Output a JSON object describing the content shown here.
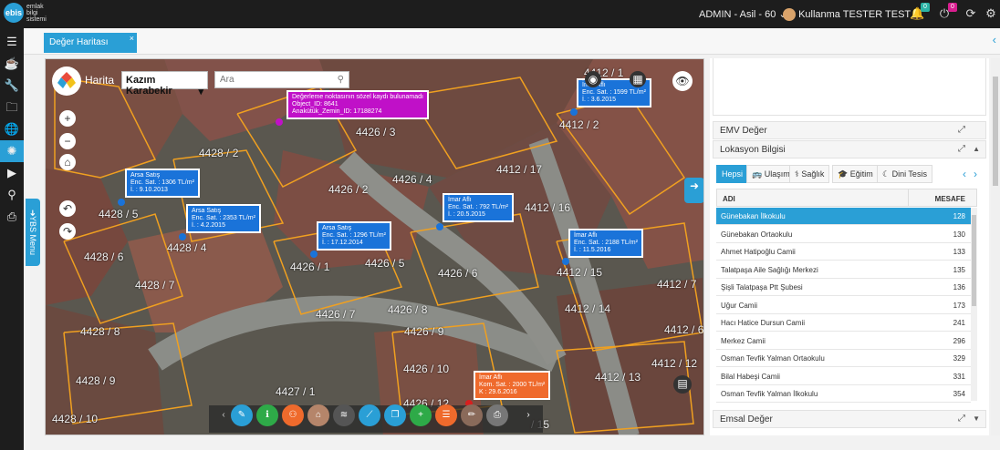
{
  "app": {
    "logo_text": "ebis",
    "logo_sub": [
      "emlak",
      "bilgi",
      "sistemi"
    ],
    "user_role": "ADMIN - Asil - 60",
    "user_name": "Kullanma TESTER TEST",
    "notifications_count": "0",
    "alerts_count": "0"
  },
  "tab": {
    "label": "Değer Haritası",
    "close": "×"
  },
  "side_tab": "YBS Menu",
  "map": {
    "label": "Harita",
    "district": "Kazım Karabekir",
    "search_placeholder": "Ara",
    "parcels": [
      "4428 / 2",
      "4426 / 3",
      "4426 / 4",
      "4426 / 2",
      "4428 / 5",
      "4428 / 4",
      "4428 / 6",
      "4428 / 7",
      "4428 / 8",
      "4428 / 9",
      "4428 / 10",
      "4426 / 1",
      "4426 / 5",
      "4426 / 6",
      "4426 / 7",
      "4426 / 8",
      "4426 / 9",
      "4426 / 10",
      "4426 / 12",
      "4427 / 1",
      "4412 / 1",
      "4412 / 2",
      "4412 / 17",
      "4412 / 16",
      "4412 / 15",
      "4412 / 14",
      "4412 / 13",
      "4412 / 7",
      "4412 / 12",
      "4412 / 6",
      "/ 15"
    ],
    "popups": [
      {
        "lines": [
          "Değerleme noktasının sözel kaydı bulunamadı",
          "Object_ID: 8641",
          "Anakütük_Zemin_ID: 17188274"
        ],
        "color": "purple"
      },
      {
        "lines": [
          "İmar Aflı",
          "Enc. Sat. : 1599 TL/m²",
          "İ. : 3.6.2015"
        ],
        "color": "blue"
      },
      {
        "lines": [
          "Arsa Satış",
          "Enc. Sat. : 1306 TL/m²",
          "İ. : 9.10.2013"
        ],
        "color": "blue"
      },
      {
        "lines": [
          "Arsa Satış",
          "Enc. Sat. : 2353 TL/m²",
          "İ. : 4.2.2015"
        ],
        "color": "blue"
      },
      {
        "lines": [
          "Arsa Satış",
          "Enc. Sat. : 1296 TL/m²",
          "İ. : 17.12.2014"
        ],
        "color": "blue"
      },
      {
        "lines": [
          "İmar Aflı",
          "Enc. Sat. : 792 TL/m²",
          "İ. : 20.5.2015"
        ],
        "color": "blue"
      },
      {
        "lines": [
          "İmar Aflı",
          "Enc. Sat. : 2188 TL/m²",
          "İ. : 11.5.2016"
        ],
        "color": "blue"
      },
      {
        "lines": [
          "İmar Aflı",
          "Kom. Sat. : 2000 TL/m²",
          "K : 29.6.2016"
        ],
        "color": "orange"
      }
    ]
  },
  "panel": {
    "emv_label": "EMV Değer",
    "lokasyon_label": "Lokasyon Bilgisi",
    "emsal_label": "Emsal Değer",
    "category_tabs": [
      "Hepsi",
      "Ulaşım",
      "Sağlık",
      "Eğitim",
      "Dini Tesis"
    ],
    "table_headers": {
      "name": "ADI",
      "distance": "MESAFE"
    },
    "rows": [
      {
        "name": "Günebakan İlkokulu",
        "distance": "128"
      },
      {
        "name": "Günebakan Ortaokulu",
        "distance": "130"
      },
      {
        "name": "Ahmet Hatipoğlu Camii",
        "distance": "133"
      },
      {
        "name": "Talatpaşa Aile Sağlığı Merkezi",
        "distance": "135"
      },
      {
        "name": "Şişli Talatpaşa Ptt Şubesi",
        "distance": "136"
      },
      {
        "name": "Uğur Camii",
        "distance": "173"
      },
      {
        "name": "Hacı Hatice Dursun Camii",
        "distance": "241"
      },
      {
        "name": "Merkez Camii",
        "distance": "296"
      },
      {
        "name": "Osman Tevfik Yalman Ortaokulu",
        "distance": "329"
      },
      {
        "name": "Bilal Habeşi Camii",
        "distance": "331"
      },
      {
        "name": "Osman Tevfik Yalman İlkokulu",
        "distance": "354"
      }
    ]
  }
}
